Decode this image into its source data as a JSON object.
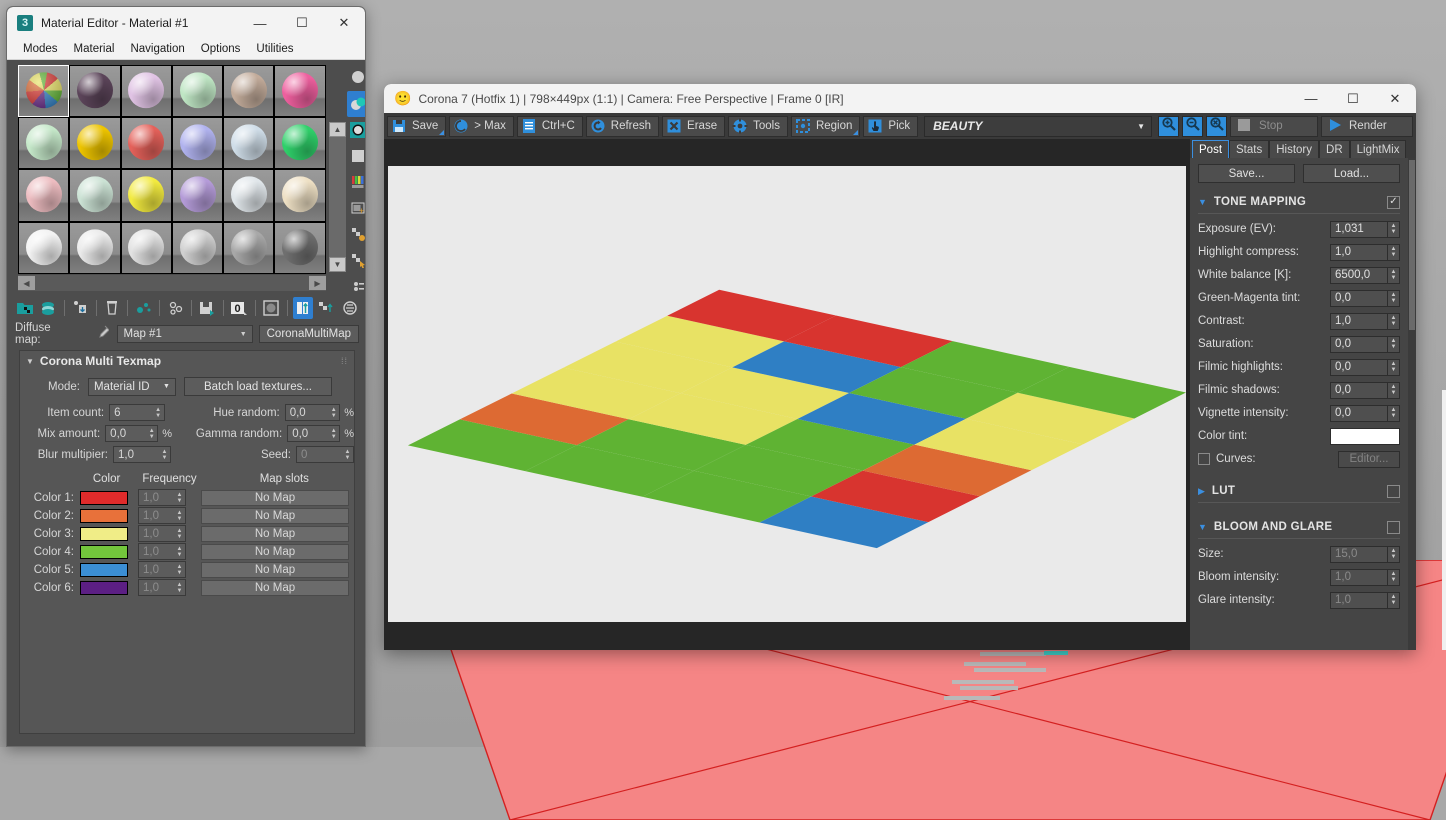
{
  "material_editor": {
    "title": "Material Editor - Material #1",
    "app_icon": "3",
    "window_buttons": {
      "minimize": "—",
      "maximize": "☐",
      "close": "✕"
    },
    "menus": [
      "Modes",
      "Material",
      "Navigation",
      "Options",
      "Utilities"
    ],
    "slots": [
      [
        {
          "name": "multi-colored-sphere",
          "color": "#b8443c",
          "selected": true
        },
        {
          "name": "dark-purple",
          "color": "#5b4459",
          "selected": false
        },
        {
          "name": "light-lilac",
          "color": "#e0c3e4",
          "selected": false
        },
        {
          "name": "pale-green",
          "color": "#bfe6c4",
          "selected": false
        },
        {
          "name": "tan-beige",
          "color": "#c2ab9a",
          "selected": false
        },
        {
          "name": "hot-pink",
          "color": "#ee5f9e",
          "selected": false
        }
      ],
      [
        {
          "name": "mint-green",
          "color": "#c5e8c9",
          "selected": false
        },
        {
          "name": "golden-yellow",
          "color": "#edc400",
          "selected": false
        },
        {
          "name": "salmon-red",
          "color": "#e4615a",
          "selected": false
        },
        {
          "name": "periwinkle",
          "color": "#b0b2ee",
          "selected": false
        },
        {
          "name": "pale-blue",
          "color": "#cfdde8",
          "selected": false
        },
        {
          "name": "bright-green",
          "color": "#2fd06a",
          "selected": false
        }
      ],
      [
        {
          "name": "soft-pink",
          "color": "#edbcc0",
          "selected": false
        },
        {
          "name": "sea-foam",
          "color": "#cbe2d4",
          "selected": false
        },
        {
          "name": "lemon-yellow",
          "color": "#f2ea3f",
          "selected": false
        },
        {
          "name": "lavender",
          "color": "#b49bd8",
          "selected": false
        },
        {
          "name": "ice-white",
          "color": "#e0e6ea",
          "selected": false
        },
        {
          "name": "cream",
          "color": "#eee0c4",
          "selected": false
        }
      ],
      [
        {
          "name": "white-1",
          "color": "#f2f2f2",
          "selected": false
        },
        {
          "name": "white-2",
          "color": "#eaeaea",
          "selected": false
        },
        {
          "name": "white-3",
          "color": "#e2e2e2",
          "selected": false
        },
        {
          "name": "grey-1",
          "color": "#d0d0d0",
          "selected": false
        },
        {
          "name": "grey-2",
          "color": "#a8a8a8",
          "selected": false
        },
        {
          "name": "grey-3",
          "color": "#6f6f6f",
          "selected": false
        }
      ]
    ],
    "diffuse_map": {
      "label": "Diffuse map:",
      "picker_icon": "eyedropper-icon",
      "map_name": "Map #1",
      "map_type": "CoronaMultiMap"
    },
    "rollout": {
      "title": "Corona Multi Texmap",
      "mode_label": "Mode:",
      "mode_value": "Material ID",
      "batch_button": "Batch load textures...",
      "numerics": [
        {
          "label": "Item count:",
          "value": "6",
          "disabled": false,
          "suffix": ""
        },
        {
          "label": "Mix amount:",
          "value": "0,0",
          "disabled": false,
          "suffix": "%"
        },
        {
          "label": "Blur multipier:",
          "value": "1,0",
          "disabled": false,
          "suffix": ""
        },
        {
          "label": "Hue random:",
          "value": "0,0",
          "disabled": false,
          "suffix": "%"
        },
        {
          "label": "Gamma random:",
          "value": "0,0",
          "disabled": false,
          "suffix": "%"
        },
        {
          "label": "Seed:",
          "value": "0",
          "disabled": true,
          "suffix": ""
        }
      ],
      "table_headers": {
        "color": "Color",
        "frequency": "Frequency",
        "map_slots": "Map slots"
      },
      "rows": [
        {
          "label": "Color 1:",
          "color": "#e02b2b",
          "frequency": "1,0",
          "map": "No Map"
        },
        {
          "label": "Color 2:",
          "color": "#e8713a",
          "frequency": "1,0",
          "map": "No Map"
        },
        {
          "label": "Color 3:",
          "color": "#f0ed87",
          "frequency": "1,0",
          "map": "No Map"
        },
        {
          "label": "Color 4:",
          "color": "#73c63c",
          "frequency": "1,0",
          "map": "No Map"
        },
        {
          "label": "Color 5:",
          "color": "#3b8ed4",
          "frequency": "1,0",
          "map": "No Map"
        },
        {
          "label": "Color 6:",
          "color": "#5c1f84",
          "frequency": "1,0",
          "map": "No Map"
        }
      ]
    }
  },
  "vfb": {
    "title": "Corona 7 (Hotfix 1) | 798×449px (1:1) | Camera: Free Perspective | Frame 0 [IR]",
    "window_buttons": {
      "minimize": "—",
      "maximize": "☐",
      "close": "✕"
    },
    "toolbar": [
      {
        "label": "Save",
        "icon": "save-icon",
        "sub": true
      },
      {
        "label": "> Max",
        "icon": "max-icon",
        "sub": false
      },
      {
        "label": "Ctrl+C",
        "icon": "copy-icon",
        "sub": false
      },
      {
        "label": "Refresh",
        "icon": "refresh-icon",
        "sub": false
      },
      {
        "label": "Erase",
        "icon": "erase-icon",
        "sub": false
      },
      {
        "label": "Tools",
        "icon": "gear-icon",
        "sub": false
      },
      {
        "label": "Region",
        "icon": "region-icon",
        "sub": true
      },
      {
        "label": "Pick",
        "icon": "pick-icon",
        "sub": false
      }
    ],
    "pass_selector": "BEAUTY",
    "zoom_buttons": [
      "zoom-in-icon",
      "zoom-out-icon",
      "zoom-reset-icon"
    ],
    "stop_label": "Stop",
    "render_label": "Render",
    "tabs": [
      {
        "label": "Post",
        "active": true
      },
      {
        "label": "Stats",
        "active": false
      },
      {
        "label": "History",
        "active": false
      },
      {
        "label": "DR",
        "active": false
      },
      {
        "label": "LightMix",
        "active": false
      }
    ],
    "panel": {
      "save_label": "Save...",
      "load_label": "Load...",
      "sections": [
        {
          "name": "TONE MAPPING",
          "expanded": true,
          "checked": true,
          "rows": [
            {
              "label": "Exposure (EV):",
              "value": "1,031",
              "kind": "spin",
              "disabled": false
            },
            {
              "label": "Highlight compress:",
              "value": "1,0",
              "kind": "spin",
              "disabled": false
            },
            {
              "label": "White balance [K]:",
              "value": "6500,0",
              "kind": "spin",
              "disabled": false
            },
            {
              "label": "Green-Magenta tint:",
              "value": "0,0",
              "kind": "spin",
              "disabled": false
            },
            {
              "label": "Contrast:",
              "value": "1,0",
              "kind": "spin",
              "disabled": false
            },
            {
              "label": "Saturation:",
              "value": "0,0",
              "kind": "spin",
              "disabled": false
            },
            {
              "label": "Filmic highlights:",
              "value": "0,0",
              "kind": "spin",
              "disabled": false
            },
            {
              "label": "Filmic shadows:",
              "value": "0,0",
              "kind": "spin",
              "disabled": false
            },
            {
              "label": "Vignette intensity:",
              "value": "0,0",
              "kind": "spin",
              "disabled": false
            },
            {
              "label": "Color tint:",
              "value": "#ffffff",
              "kind": "swatch",
              "disabled": false
            },
            {
              "label": "Curves:",
              "value": "Editor...",
              "kind": "checkbox-button",
              "disabled": true
            }
          ]
        },
        {
          "name": "LUT",
          "expanded": false,
          "checked": false,
          "rows": []
        },
        {
          "name": "BLOOM AND GLARE",
          "expanded": true,
          "checked": false,
          "rows": [
            {
              "label": "Size:",
              "value": "15,0",
              "kind": "spin",
              "disabled": true
            },
            {
              "label": "Bloom intensity:",
              "value": "1,0",
              "kind": "spin",
              "disabled": true
            },
            {
              "label": "Glare intensity:",
              "value": "1,0",
              "kind": "spin",
              "disabled": true
            }
          ]
        }
      ]
    },
    "render_image": {
      "background": "#eaeaea",
      "description": "Isometric plane subdivided into colored rectangles",
      "palette": {
        "red": "#d8342f",
        "orange": "#dd6a33",
        "yellow": "#e8e264",
        "green": "#5fb333",
        "blue": "#2f7fc4"
      }
    }
  },
  "max_viewport": {
    "plane_color": "#f58585",
    "edge_color": "#d42020",
    "background_top": "#b0b0b0",
    "background_bottom": "#9e9e9e",
    "selection_highlight": "#3fd6cf"
  }
}
